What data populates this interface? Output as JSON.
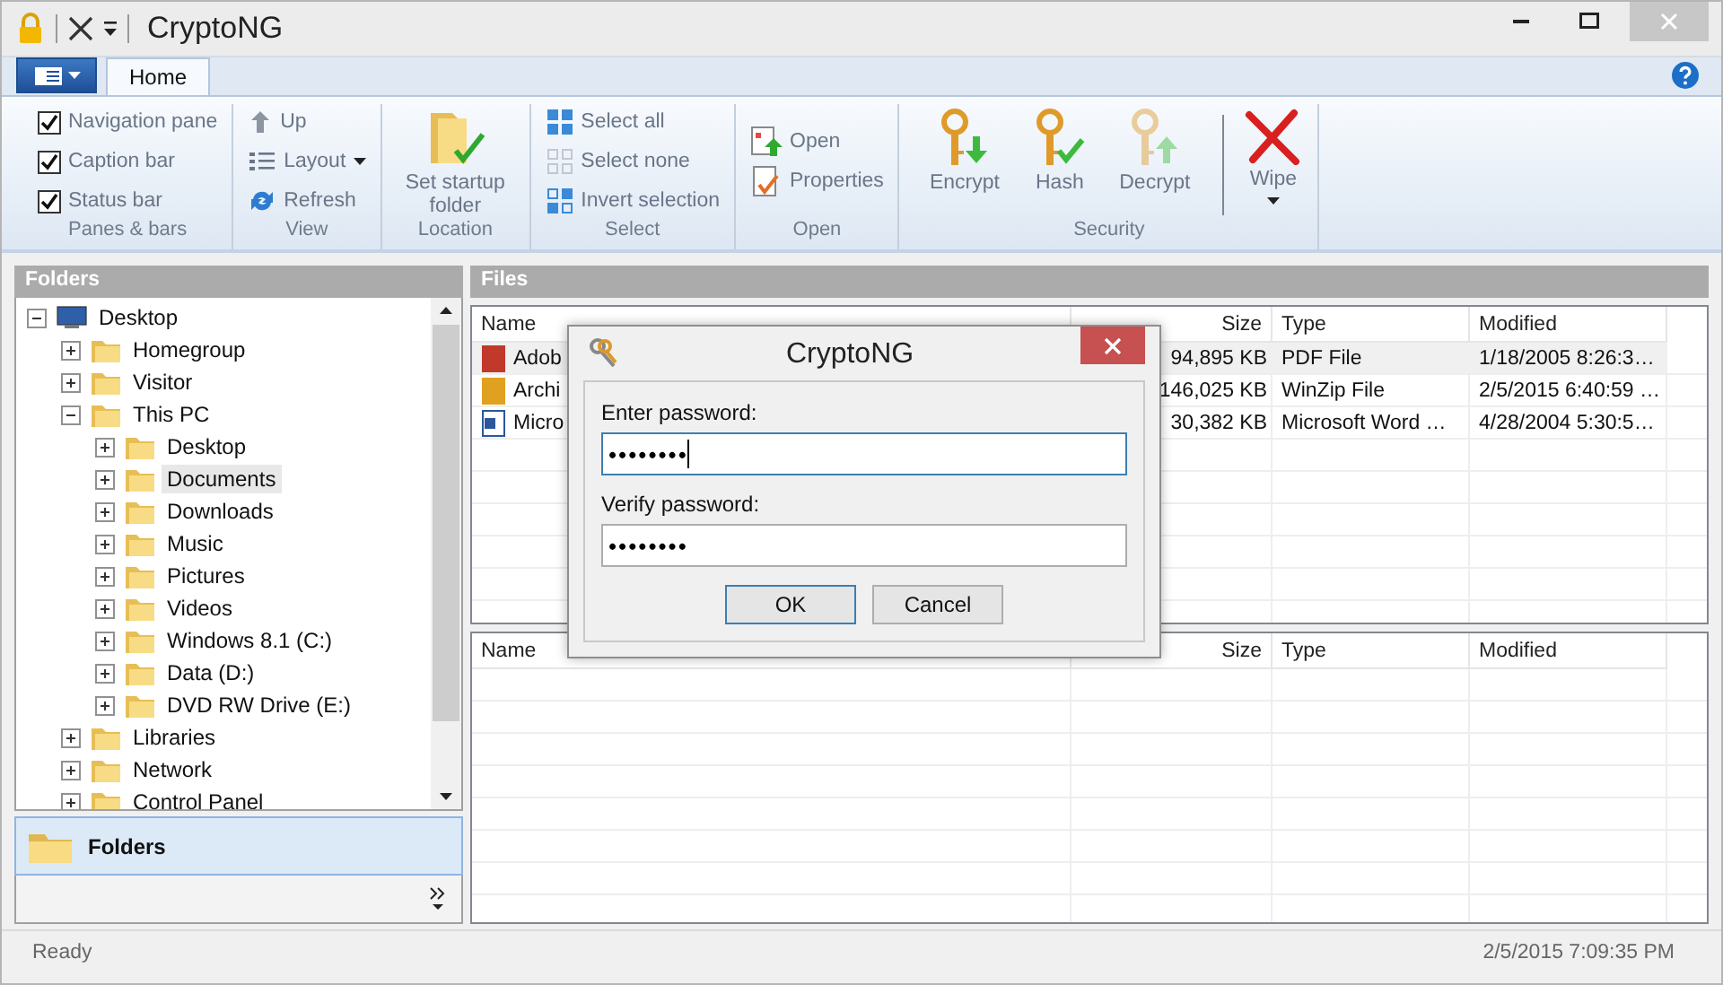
{
  "window": {
    "title": "CryptoNG"
  },
  "ribbon": {
    "tabs": [
      {
        "label": "Home",
        "selected": true
      }
    ],
    "groups": [
      {
        "label": "Panes & bars",
        "items": [
          {
            "kind": "checkbox",
            "label": "Navigation pane",
            "checked": true
          },
          {
            "kind": "checkbox",
            "label": "Caption bar",
            "checked": true
          },
          {
            "kind": "checkbox",
            "label": "Status bar",
            "checked": true
          }
        ]
      },
      {
        "label": "View",
        "items": [
          {
            "kind": "small",
            "label": "Up",
            "disabled": false
          },
          {
            "kind": "small",
            "label": "Layout",
            "dropdown": true,
            "disabled": false
          },
          {
            "kind": "small",
            "label": "Refresh",
            "disabled": false
          }
        ]
      },
      {
        "label": "Location",
        "items": [
          {
            "kind": "large",
            "label": "Set startup folder",
            "disabled": false
          }
        ]
      },
      {
        "label": "Select",
        "items": [
          {
            "kind": "small",
            "label": "Select all",
            "disabled": false
          },
          {
            "kind": "small",
            "label": "Select none",
            "disabled": true
          },
          {
            "kind": "small",
            "label": "Invert selection",
            "disabled": false
          }
        ]
      },
      {
        "label": "Open",
        "items": [
          {
            "kind": "small",
            "label": "Open",
            "disabled": false
          },
          {
            "kind": "small",
            "label": "Properties",
            "disabled": false
          }
        ]
      },
      {
        "label": "Security",
        "items": [
          {
            "kind": "large",
            "label": "Encrypt",
            "disabled": false
          },
          {
            "kind": "large",
            "label": "Hash",
            "disabled": false
          },
          {
            "kind": "large",
            "label": "Decrypt",
            "disabled": true
          },
          {
            "kind": "large",
            "label": "Wipe",
            "dropdown": true,
            "separated": true,
            "disabled": false
          }
        ]
      }
    ]
  },
  "navigation": {
    "header": "Folders",
    "tree": [
      {
        "label": "Desktop",
        "expanded": true,
        "selected": false,
        "children": [
          {
            "label": "Homegroup",
            "expanded": false,
            "selected": false
          },
          {
            "label": "Visitor",
            "expanded": false,
            "selected": false
          },
          {
            "label": "This PC",
            "expanded": true,
            "selected": false,
            "children": [
              {
                "label": "Desktop",
                "expanded": false,
                "selected": false
              },
              {
                "label": "Documents",
                "expanded": false,
                "selected": true
              },
              {
                "label": "Downloads",
                "expanded": false,
                "selected": false
              },
              {
                "label": "Music",
                "expanded": false,
                "selected": false
              },
              {
                "label": "Pictures",
                "expanded": false,
                "selected": false
              },
              {
                "label": "Videos",
                "expanded": false,
                "selected": false
              },
              {
                "label": "Windows 8.1 (C:)",
                "expanded": false,
                "selected": false
              },
              {
                "label": "Data (D:)",
                "expanded": false,
                "selected": false
              },
              {
                "label": "DVD RW Drive (E:)",
                "expanded": false,
                "selected": false
              }
            ]
          },
          {
            "label": "Libraries",
            "expanded": false,
            "selected": false
          },
          {
            "label": "Network",
            "expanded": false,
            "selected": false
          },
          {
            "label": "Control Panel",
            "expanded": false,
            "selected": false
          }
        ]
      }
    ],
    "button": {
      "label": "Folders",
      "selected": true
    }
  },
  "files": {
    "header": "Files",
    "upper_list": {
      "columns": [
        "Name",
        "Size",
        "Type",
        "Modified"
      ],
      "rows": [
        {
          "name": "Adob",
          "size": "94,895 KB",
          "type": "PDF File",
          "modified": "1/18/2005 8:26:3…",
          "selected": true
        },
        {
          "name": "Archi",
          "size": "146,025 KB",
          "type": "WinZip File",
          "modified": "2/5/2015 6:40:59 …",
          "selected": false
        },
        {
          "name": "Micro",
          "size": "30,382 KB",
          "type": "Microsoft Word …",
          "modified": "4/28/2004 5:30:5…",
          "selected": false
        }
      ]
    },
    "lower_list": {
      "columns": [
        "Name",
        "Size",
        "Type",
        "Modified"
      ]
    }
  },
  "dialog": {
    "title": "CryptoNG",
    "fields": [
      {
        "label": "Enter password:",
        "value": "••••••••",
        "focused": true
      },
      {
        "label": "Verify password:",
        "value": "••••••••",
        "focused": false
      }
    ],
    "buttons": [
      {
        "label": "OK",
        "default": true
      },
      {
        "label": "Cancel",
        "default": false
      }
    ]
  },
  "status_bar": {
    "text": "Ready",
    "time": "2/5/2015 7:09:35 PM"
  }
}
